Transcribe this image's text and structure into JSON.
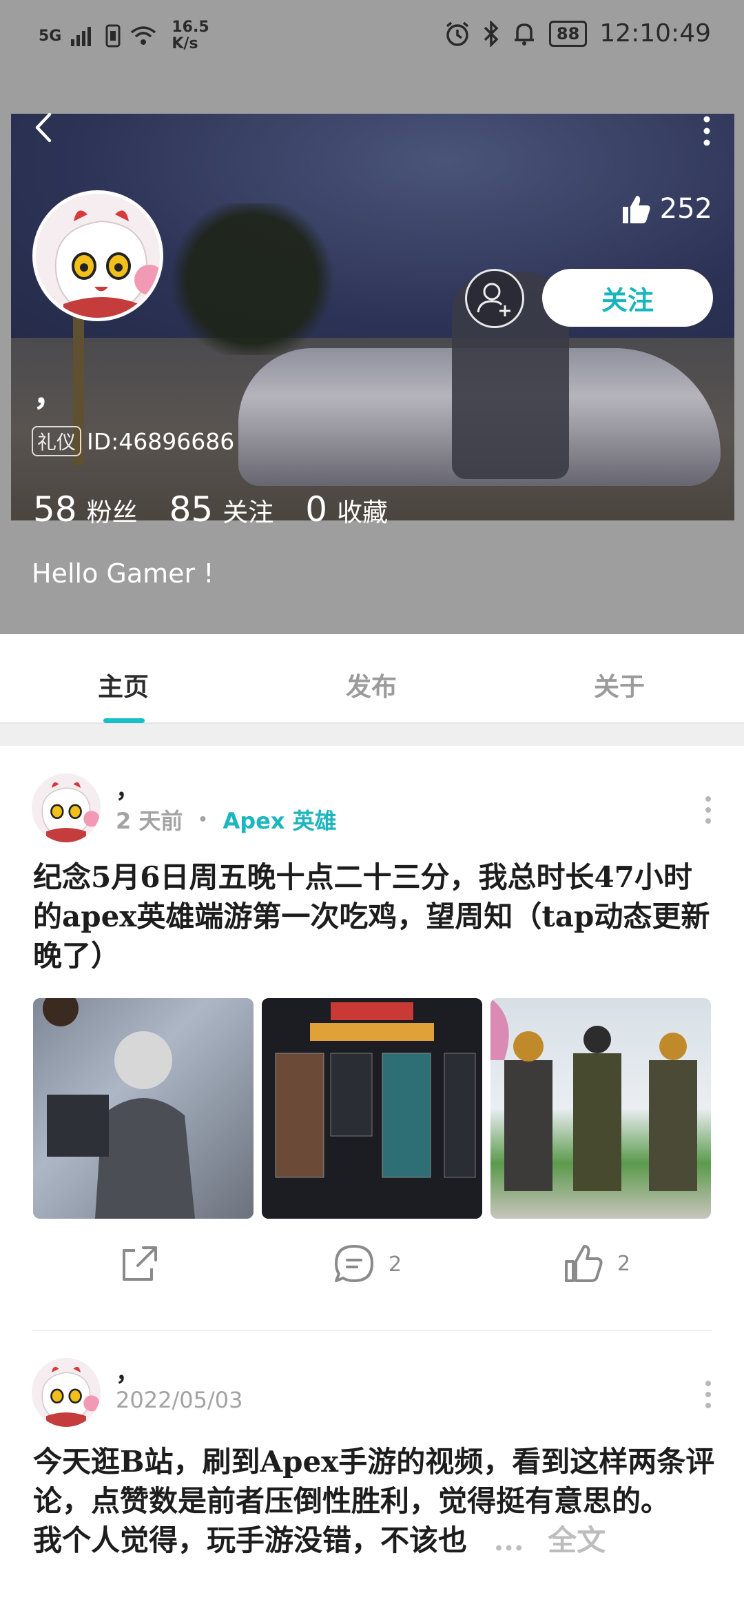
{
  "status_bar": {
    "network": "5G",
    "speed_value": "16.5",
    "speed_unit": "K/s",
    "battery": "88",
    "time": "12:10:49"
  },
  "profile": {
    "likes": "252",
    "follow_label": "关注",
    "username": "，",
    "badge": "礼仪",
    "id_text": "ID:46896686",
    "stats": [
      {
        "num": "58",
        "label": "粉丝"
      },
      {
        "num": "85",
        "label": "关注"
      },
      {
        "num": "0",
        "label": "收藏"
      }
    ],
    "bio": "Hello Gamer !"
  },
  "tabs": [
    {
      "label": "主页",
      "active": true
    },
    {
      "label": "发布",
      "active": false
    },
    {
      "label": "关于",
      "active": false
    }
  ],
  "posts": [
    {
      "author": "，",
      "time": "2 天前",
      "dot": "•",
      "tag": "Apex 英雄",
      "text": "纪念5月6日周五晚十点二十三分，我总时长47小时的apex英雄端游第一次吃鸡，望周知（tap动态更新晚了）",
      "comments": "2",
      "likes": "2"
    },
    {
      "author": "，",
      "time": "2022/05/03",
      "text_line1": "今天逛B站，刷到Apex手游的视频，看到这样两条评论，点赞数是前者压倒性胜利，觉得挺有意思的。",
      "text_line2": "我个人觉得，玩手游没错，不该也",
      "ellipsis": "...",
      "more_label": "全文"
    }
  ],
  "colors": {
    "accent": "#19bfc6",
    "header_bg": "#9e9e9e"
  }
}
